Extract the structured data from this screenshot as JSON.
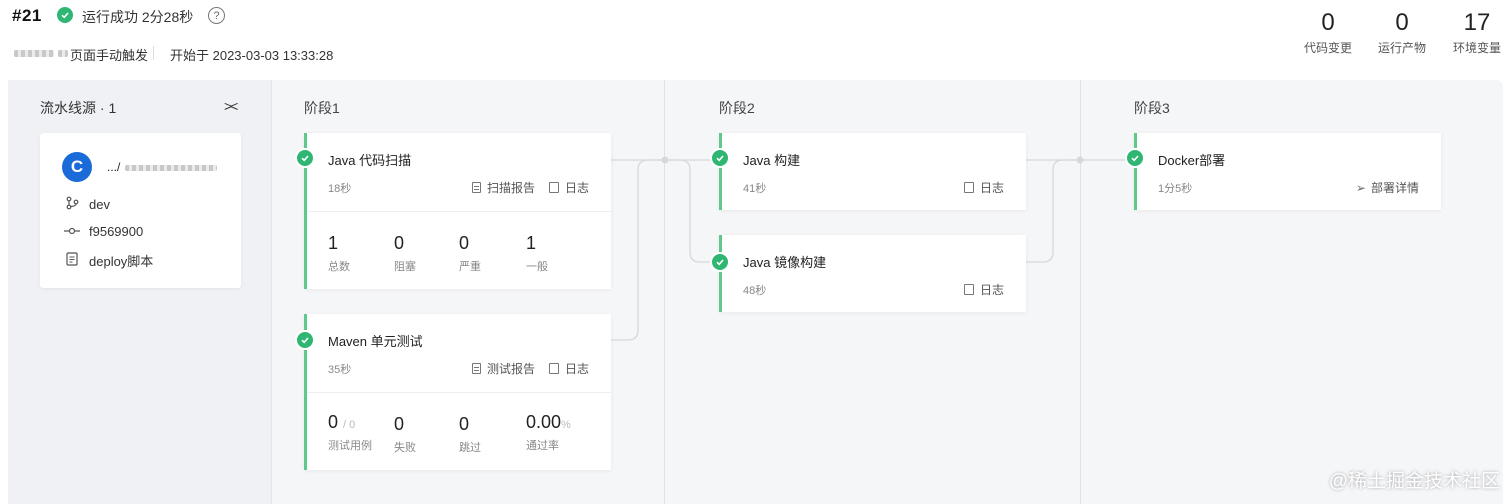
{
  "header": {
    "run_id": "#21",
    "status_text": "运行成功 2分28秒",
    "help_label": "?",
    "trigger": "页面手动触发",
    "started": "开始于 2023-03-03 13:33:28",
    "stats": [
      {
        "value": "0",
        "label": "代码变更"
      },
      {
        "value": "0",
        "label": "运行产物"
      },
      {
        "value": "17",
        "label": "环境变量"
      }
    ]
  },
  "source": {
    "title": "流水线源 · 1",
    "collapse_label": "><",
    "logo_letter": "C",
    "repo_name": ".../",
    "branch": "dev",
    "commit": "f9569900",
    "script": "deploy脚本"
  },
  "stages": [
    {
      "title": "阶段1",
      "jobs": [
        {
          "name": "Java 代码扫描",
          "duration": "18秒",
          "links": [
            "扫描报告",
            "日志"
          ],
          "metrics": [
            {
              "value": "1",
              "label": "总数"
            },
            {
              "value": "0",
              "label": "阻塞"
            },
            {
              "value": "0",
              "label": "严重"
            },
            {
              "value": "1",
              "label": "一般"
            }
          ]
        },
        {
          "name": "Maven 单元测试",
          "duration": "35秒",
          "links": [
            "测试报告",
            "日志"
          ],
          "metrics": [
            {
              "value": "0",
              "suffix": "/ 0",
              "label": "测试用例"
            },
            {
              "value": "0",
              "label": "失败"
            },
            {
              "value": "0",
              "label": "跳过"
            },
            {
              "value": "0.00",
              "suffix": "%",
              "label": "通过率"
            }
          ]
        }
      ]
    },
    {
      "title": "阶段2",
      "jobs": [
        {
          "name": "Java 构建",
          "duration": "41秒",
          "links": [
            "日志"
          ]
        },
        {
          "name": "Java 镜像构建",
          "duration": "48秒",
          "links": [
            "日志"
          ]
        }
      ]
    },
    {
      "title": "阶段3",
      "jobs": [
        {
          "name": "Docker部署",
          "duration": "1分5秒",
          "links": [
            "部署详情"
          ]
        }
      ]
    }
  ],
  "watermark": "@稀土掘金技术社区",
  "colors": {
    "success": "#2fb673",
    "job_border": "#5fc98b",
    "logo": "#1a6bd8"
  }
}
